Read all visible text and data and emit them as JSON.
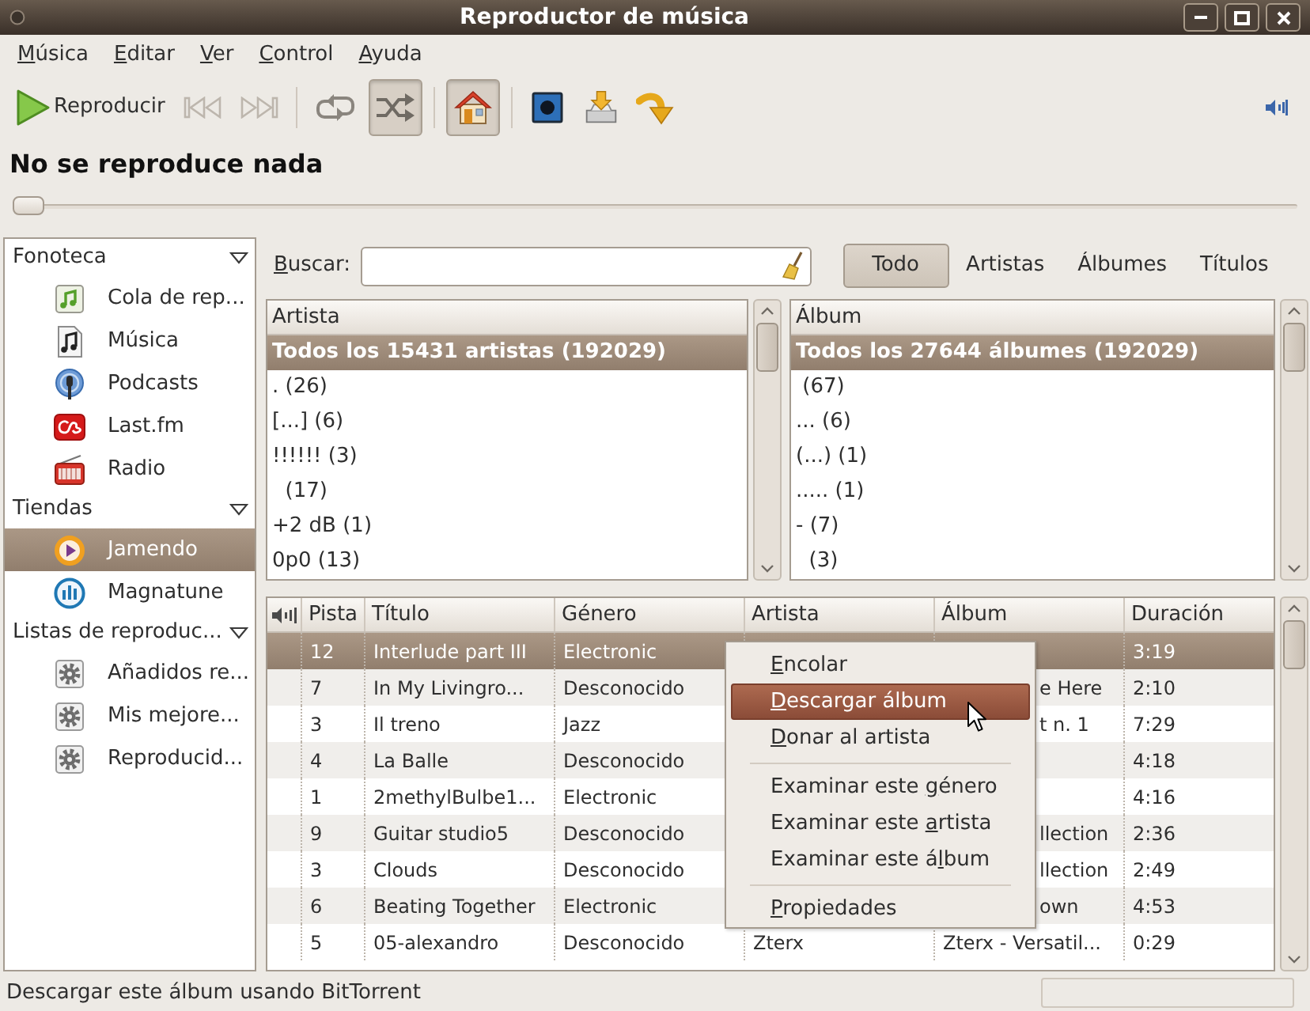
{
  "window": {
    "title": "Reproductor de música"
  },
  "menu_bar": [
    {
      "key": "M",
      "after": "úsica"
    },
    {
      "key": "E",
      "after": "ditar"
    },
    {
      "key": "V",
      "after": "er"
    },
    {
      "key": "C",
      "after": "ontrol"
    },
    {
      "key": "A",
      "after": "yuda"
    }
  ],
  "toolbar": {
    "items": [
      {
        "kind": "play",
        "label": "Reproducir"
      },
      {
        "kind": "previous",
        "disabled": true
      },
      {
        "kind": "next",
        "disabled": true
      },
      {
        "kind": "separator"
      },
      {
        "kind": "repeat",
        "on": false
      },
      {
        "kind": "shuffle",
        "on": true
      },
      {
        "kind": "separator"
      },
      {
        "kind": "home",
        "on": true
      },
      {
        "kind": "separator"
      },
      {
        "kind": "screen"
      },
      {
        "kind": "tray"
      },
      {
        "kind": "turn"
      }
    ]
  },
  "now_playing": {
    "text": "No se reproduce nada",
    "level": 0
  },
  "sidebar": {
    "groups": [
      {
        "label": "Fonoteca",
        "expanded": true,
        "children": [
          {
            "label": "Cola de rep...",
            "kind": "queue",
            "selected": false
          },
          {
            "label": "Música",
            "kind": "music",
            "selected": false
          },
          {
            "label": "Podcasts",
            "kind": "podcast",
            "selected": false
          },
          {
            "label": "Last.fm",
            "kind": "lastfm",
            "selected": false
          },
          {
            "label": "Radio",
            "kind": "radio",
            "selected": false
          }
        ]
      },
      {
        "label": "Tiendas",
        "expanded": true,
        "children": [
          {
            "label": "Jamendo",
            "kind": "jamendo",
            "selected": true
          },
          {
            "label": "Magnatune",
            "kind": "magnatune",
            "selected": false
          }
        ]
      },
      {
        "label": "Listas de reproduc...",
        "expanded": true,
        "children": [
          {
            "label": "Añadidos re...",
            "kind": "playlist",
            "selected": false
          },
          {
            "label": "Mis mejore...",
            "kind": "playlist",
            "selected": false
          },
          {
            "label": "Reproducid...",
            "kind": "playlist",
            "selected": false
          }
        ]
      }
    ]
  },
  "search": {
    "key": "B",
    "after": "uscar:"
  },
  "filters": [
    {
      "label": "Todo",
      "selected": true
    },
    {
      "label": "Artistas",
      "selected": false
    },
    {
      "label": "Álbumes",
      "selected": false
    },
    {
      "label": "Títulos",
      "selected": false
    }
  ],
  "artist_pane": {
    "heading": "Artista",
    "rows": [
      {
        "text": "Todos los 15431 artistas (192029)",
        "selected": true
      },
      {
        "text": ". (26)",
        "selected": false
      },
      {
        "text": "[...] (6)",
        "selected": false
      },
      {
        "text": "!!!!!! (3)",
        "selected": false
      },
      {
        "text": "  (17)",
        "selected": false
      },
      {
        "text": "+2 dB (1)",
        "selected": false
      },
      {
        "text": "0p0 (13)",
        "selected": false
      }
    ]
  },
  "album_pane": {
    "heading": "Álbum",
    "rows": [
      {
        "text": "Todos los 27644 álbumes (192029)",
        "selected": true
      },
      {
        "text": " (67)",
        "selected": false
      },
      {
        "text": "... (6)",
        "selected": false
      },
      {
        "text": "(...) (1)",
        "selected": false
      },
      {
        "text": "..... (1)",
        "selected": false
      },
      {
        "text": "- (7)",
        "selected": false
      },
      {
        "text": "  (3)",
        "selected": false
      }
    ]
  },
  "track_list": {
    "columns": [
      "Pista",
      "Título",
      "Género",
      "Artista",
      "Álbum",
      "Duración"
    ],
    "rows": [
      {
        "track": "12",
        "title": "Interlude part III",
        "genre": "Electronic",
        "duration": "3:19",
        "selected": true
      },
      {
        "track": "7",
        "title": "In My Livingro...",
        "genre": "Desconocido",
        "album_tail": "e Here",
        "duration": "2:10",
        "selected": false
      },
      {
        "track": "3",
        "title": "Il treno",
        "genre": "Jazz",
        "album_tail": "t n. 1",
        "duration": "7:29",
        "selected": false
      },
      {
        "track": "4",
        "title": "La Balle",
        "genre": "Desconocido",
        "duration": "4:18",
        "selected": false
      },
      {
        "track": "1",
        "title": "2methylBulbe1...",
        "genre": "Electronic",
        "duration": "4:16",
        "selected": false
      },
      {
        "track": "9",
        "title": "Guitar studio5",
        "genre": "Desconocido",
        "album_tail": "llection",
        "duration": "2:36",
        "selected": false
      },
      {
        "track": "3",
        "title": "Clouds",
        "genre": "Desconocido",
        "album_tail": "llection",
        "duration": "2:49",
        "selected": false
      },
      {
        "track": "6",
        "title": "Beating Together",
        "genre": "Electronic",
        "album_tail": "own",
        "duration": "4:53",
        "selected": false
      },
      {
        "track": "5",
        "title": "05-alexandro",
        "genre": "Desconocido",
        "artist": "Zterx",
        "album": "Zterx - Versatil...",
        "duration": "0:29",
        "selected": false
      }
    ]
  },
  "context_menu": {
    "items": [
      {
        "kind": "item",
        "key": "E",
        "after": "ncolar",
        "selected": false
      },
      {
        "kind": "item",
        "key": "D",
        "after": "escargar álbum",
        "selected": true
      },
      {
        "kind": "item",
        "key": "D",
        "after": "onar al artista",
        "selected": false
      },
      {
        "kind": "separator"
      },
      {
        "kind": "item",
        "before": "Examinar este ",
        "key": "g",
        "after": "énero",
        "selected": false
      },
      {
        "kind": "item",
        "before": "Examinar este ",
        "key": "a",
        "after": "rtista",
        "selected": false
      },
      {
        "kind": "item",
        "before": "Examinar este á",
        "key": "l",
        "after": "bum",
        "selected": false
      },
      {
        "kind": "separator"
      },
      {
        "kind": "item",
        "key": "P",
        "after": "ropiedades",
        "selected": false
      }
    ]
  },
  "status_bar": {
    "text": "Descargar este álbum usando BitTorrent"
  }
}
